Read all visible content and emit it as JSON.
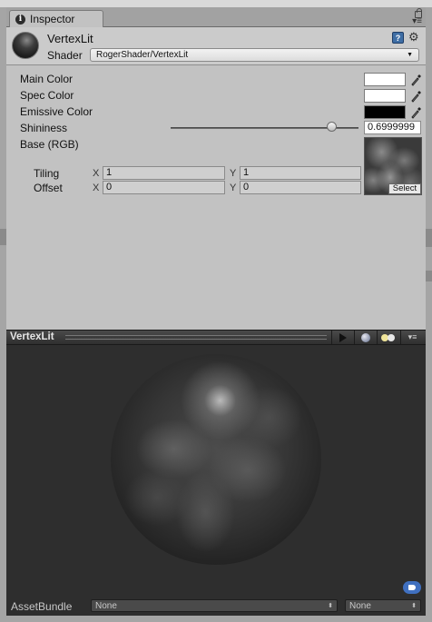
{
  "tab": {
    "title": "Inspector"
  },
  "material": {
    "name": "VertexLit",
    "shader_label": "Shader",
    "shader_value": "RogerShader/VertexLit"
  },
  "properties": {
    "main_color": {
      "label": "Main Color",
      "color": "#ffffff"
    },
    "spec_color": {
      "label": "Spec Color",
      "color": "#ffffff"
    },
    "emissive_color": {
      "label": "Emissive Color",
      "color": "#000000"
    },
    "shininess": {
      "label": "Shininess",
      "value": "0.6999999",
      "slider_fraction": 0.857
    },
    "base": {
      "label": "Base (RGB)",
      "select_label": "Select",
      "tiling": {
        "label": "Tiling",
        "x_label": "X",
        "x": "1",
        "y_label": "Y",
        "y": "1"
      },
      "offset": {
        "label": "Offset",
        "x_label": "X",
        "x": "0",
        "y_label": "Y",
        "y": "0"
      }
    }
  },
  "preview": {
    "title": "VertexLit"
  },
  "asset_bundle": {
    "label": "AssetBundle",
    "name_value": "None",
    "variant_value": "None"
  },
  "colors": {
    "panel": "#c2c2c2",
    "preview_bg": "#2e2e2e",
    "accent": "#4070c0"
  }
}
